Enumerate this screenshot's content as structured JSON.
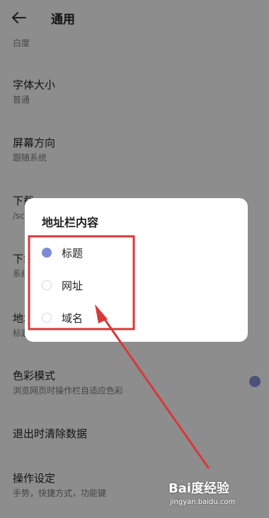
{
  "header": {
    "title": "通用",
    "back_icon": "arrow-left-icon"
  },
  "settings": {
    "prev_subtitle": "白度",
    "font_size": {
      "title": "字体大小",
      "value": "普通"
    },
    "orientation": {
      "title": "屏幕方向",
      "value": "跟随系统"
    },
    "download_path": {
      "title": "下载",
      "value": "/sc"
    },
    "download_mode": {
      "title": "下载",
      "value": "系统"
    },
    "address_bar": {
      "title": "地址",
      "value": "标题"
    },
    "color_mode": {
      "title": "色彩模式",
      "value": "浏览网页时操作栏自适应色彩",
      "toggle_on": true
    },
    "clear_on_exit": {
      "title": "退出时清除数据"
    },
    "operation": {
      "title": "操作设定",
      "value": "手势，快捷方式，功能键"
    }
  },
  "dialog": {
    "title": "地址栏内容",
    "options": [
      {
        "label": "标题",
        "selected": true
      },
      {
        "label": "网址",
        "selected": false
      },
      {
        "label": "域名",
        "selected": false
      }
    ]
  },
  "colors": {
    "accent": "#7a8bd8",
    "annotation": "#d9383a"
  },
  "watermark": {
    "brand": "Bai度经验",
    "url": "jingyan.baidu.com"
  }
}
